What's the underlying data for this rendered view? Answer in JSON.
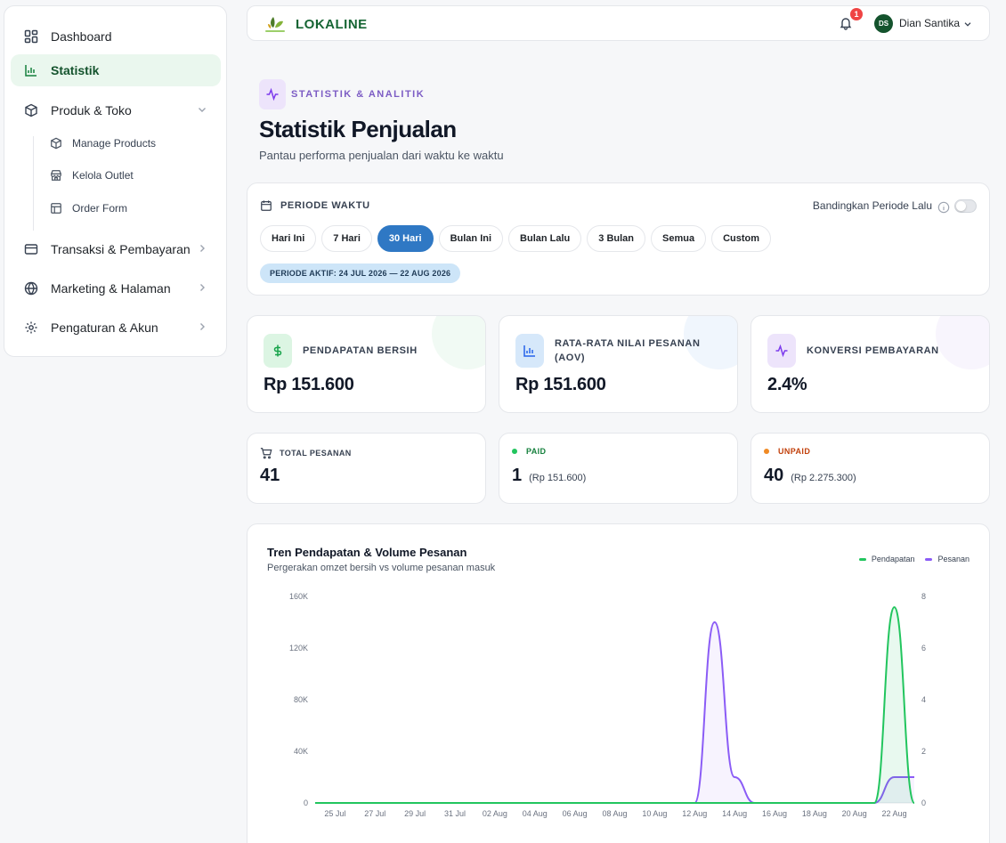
{
  "sidebar": {
    "items": [
      {
        "label": "Dashboard",
        "icon": "grid-icon"
      },
      {
        "label": "Statistik",
        "icon": "bar-chart-icon"
      },
      {
        "label": "Produk & Toko",
        "icon": "box-icon"
      },
      {
        "label": "Transaksi & Pembayaran",
        "icon": "credit-card-icon"
      },
      {
        "label": "Marketing & Halaman",
        "icon": "globe-icon"
      },
      {
        "label": "Pengaturan & Akun",
        "icon": "gear-icon"
      }
    ],
    "sub_items": [
      {
        "label": "Manage Products",
        "icon": "box-icon"
      },
      {
        "label": "Kelola Outlet",
        "icon": "store-icon"
      },
      {
        "label": "Order Form",
        "icon": "layout-icon"
      }
    ]
  },
  "header": {
    "brand": "LOKALINE",
    "notification_count": "1",
    "avatar_initials": "DS",
    "username": "Dian Santika"
  },
  "page": {
    "eyebrow": "STATISTIK & ANALITIK",
    "title": "Statistik Penjualan",
    "subtitle": "Pantau performa penjualan dari waktu ke waktu"
  },
  "period": {
    "label": "PERIODE WAKTU",
    "compare_label": "Bandingkan Periode Lalu",
    "compare_enabled": false,
    "options": [
      "Hari Ini",
      "7 Hari",
      "30 Hari",
      "Bulan Ini",
      "Bulan Lalu",
      "3 Bulan",
      "Semua",
      "Custom"
    ],
    "selected": "30 Hari",
    "active_text": "PERIODE AKTIF: 24 JUL 2026 — 22 AUG 2026"
  },
  "stats": [
    {
      "label": "PENDAPATAN BERSIH",
      "value": "Rp 151.600",
      "icon": "dollar-icon",
      "color": "#16a34a",
      "bg": "#dcf5e3"
    },
    {
      "label": "RATA-RATA NILAI PESANAN (AOV)",
      "value": "Rp 151.600",
      "icon": "bar-chart-icon",
      "color": "#2563eb",
      "bg": "#d6e8fa"
    },
    {
      "label": "KONVERSI PEMBAYARAN",
      "value": "2.4%",
      "icon": "activity-icon",
      "color": "#7c3aed",
      "bg": "#ede4fb"
    }
  ],
  "orders": {
    "total_label": "TOTAL PESANAN",
    "total_value": "41",
    "paid_label": "PAID",
    "paid_value": "1",
    "paid_amount": "(Rp 151.600)",
    "unpaid_label": "UNPAID",
    "unpaid_value": "40",
    "unpaid_amount": "(Rp 2.275.300)",
    "paid_color": "#22c55e",
    "unpaid_color": "#f08a24"
  },
  "chart_data": {
    "type": "line",
    "title": "Tren Pendapatan & Volume Pesanan",
    "subtitle": "Pergerakan omzet bersih vs volume pesanan masuk",
    "x_ticks": [
      "25 Jul",
      "27 Jul",
      "29 Jul",
      "31 Jul",
      "02 Aug",
      "04 Aug",
      "06 Aug",
      "08 Aug",
      "10 Aug",
      "12 Aug",
      "14 Aug",
      "16 Aug",
      "18 Aug",
      "20 Aug",
      "22 Aug"
    ],
    "y_left_ticks": [
      "0",
      "40K",
      "80K",
      "120K",
      "160K"
    ],
    "y_right_ticks": [
      "0",
      "2",
      "4",
      "6",
      "8"
    ],
    "y_left_range": [
      0,
      160000
    ],
    "y_right_range": [
      0,
      8
    ],
    "legend_position": "top-right",
    "series": [
      {
        "name": "Pendapatan",
        "axis": "left",
        "color": "#22c55e",
        "points": [
          [
            "24 Jul",
            0
          ],
          [
            "12 Aug",
            0
          ],
          [
            "13 Aug",
            0
          ],
          [
            "14 Aug",
            0
          ],
          [
            "15 Aug",
            0
          ],
          [
            "20 Aug",
            0
          ],
          [
            "21 Aug",
            0
          ],
          [
            "22 Aug",
            151600
          ],
          [
            "23 Aug",
            0
          ]
        ]
      },
      {
        "name": "Pesanan",
        "axis": "right",
        "color": "#8b5cf6",
        "points": [
          [
            "24 Jul",
            0
          ],
          [
            "12 Aug",
            0
          ],
          [
            "13 Aug",
            7
          ],
          [
            "14 Aug",
            1
          ],
          [
            "15 Aug",
            0
          ],
          [
            "20 Aug",
            0
          ],
          [
            "21 Aug",
            0
          ],
          [
            "22 Aug",
            1
          ],
          [
            "23 Aug",
            1
          ]
        ]
      }
    ]
  }
}
